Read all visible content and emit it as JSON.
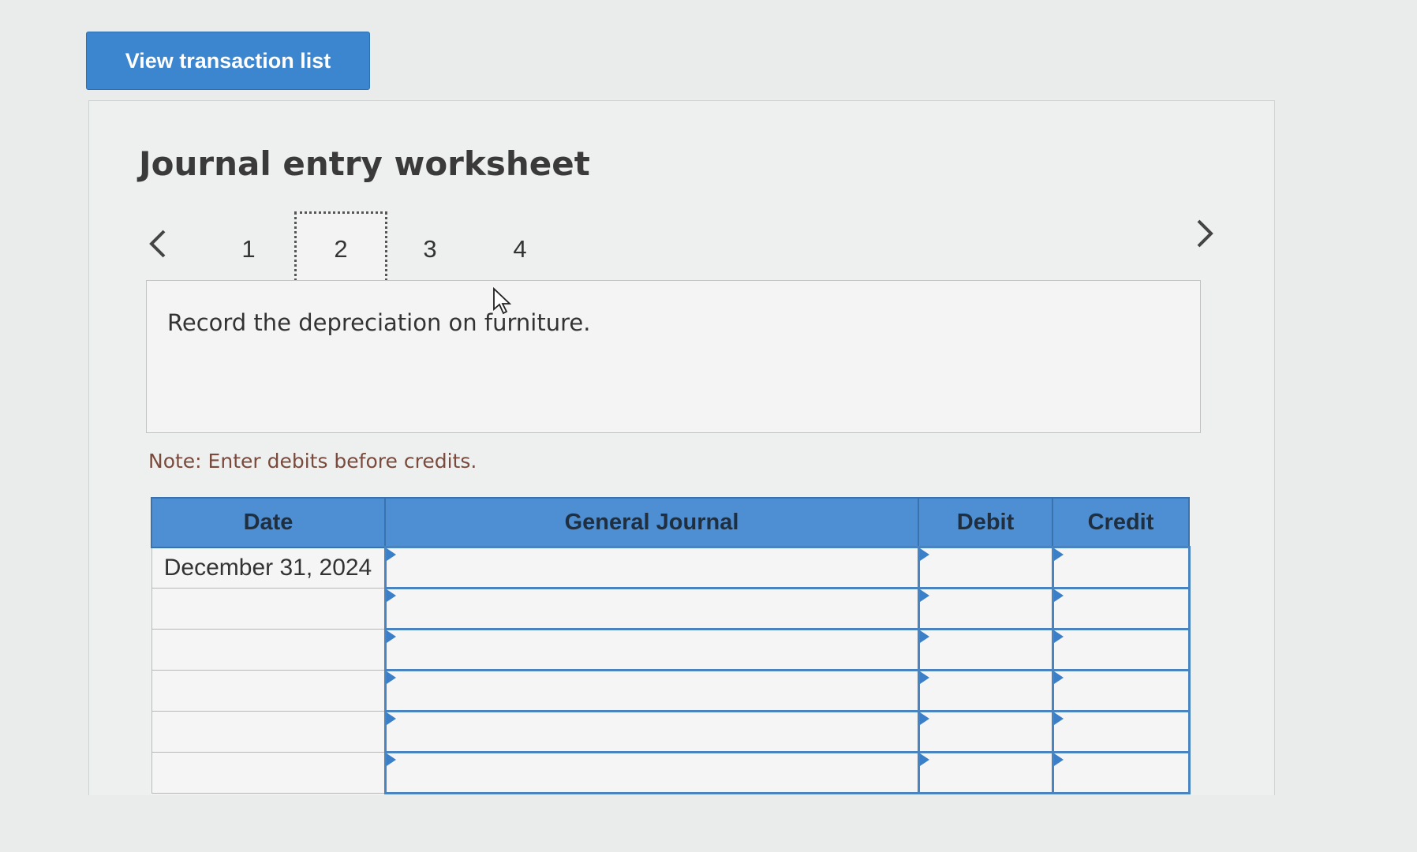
{
  "toolbar": {
    "view_transaction_list_label": "View transaction list"
  },
  "worksheet": {
    "title": "Journal entry worksheet",
    "tabs": [
      {
        "label": "1"
      },
      {
        "label": "2"
      },
      {
        "label": "3"
      },
      {
        "label": "4"
      }
    ],
    "active_tab": "2",
    "instruction": "Record the depreciation on furniture.",
    "note": "Note: Enter debits before credits."
  },
  "journal": {
    "headers": {
      "date": "Date",
      "general_journal": "General Journal",
      "debit": "Debit",
      "credit": "Credit"
    },
    "rows": [
      {
        "date": "December 31, 2024",
        "account": "",
        "debit": "",
        "credit": ""
      },
      {
        "date": "",
        "account": "",
        "debit": "",
        "credit": ""
      },
      {
        "date": "",
        "account": "",
        "debit": "",
        "credit": ""
      },
      {
        "date": "",
        "account": "",
        "debit": "",
        "credit": ""
      },
      {
        "date": "",
        "account": "",
        "debit": "",
        "credit": ""
      },
      {
        "date": "",
        "account": "",
        "debit": "",
        "credit": ""
      }
    ]
  },
  "colors": {
    "accent": "#3c86cf",
    "header": "#4d8fd2",
    "note": "#7a4a3c"
  }
}
